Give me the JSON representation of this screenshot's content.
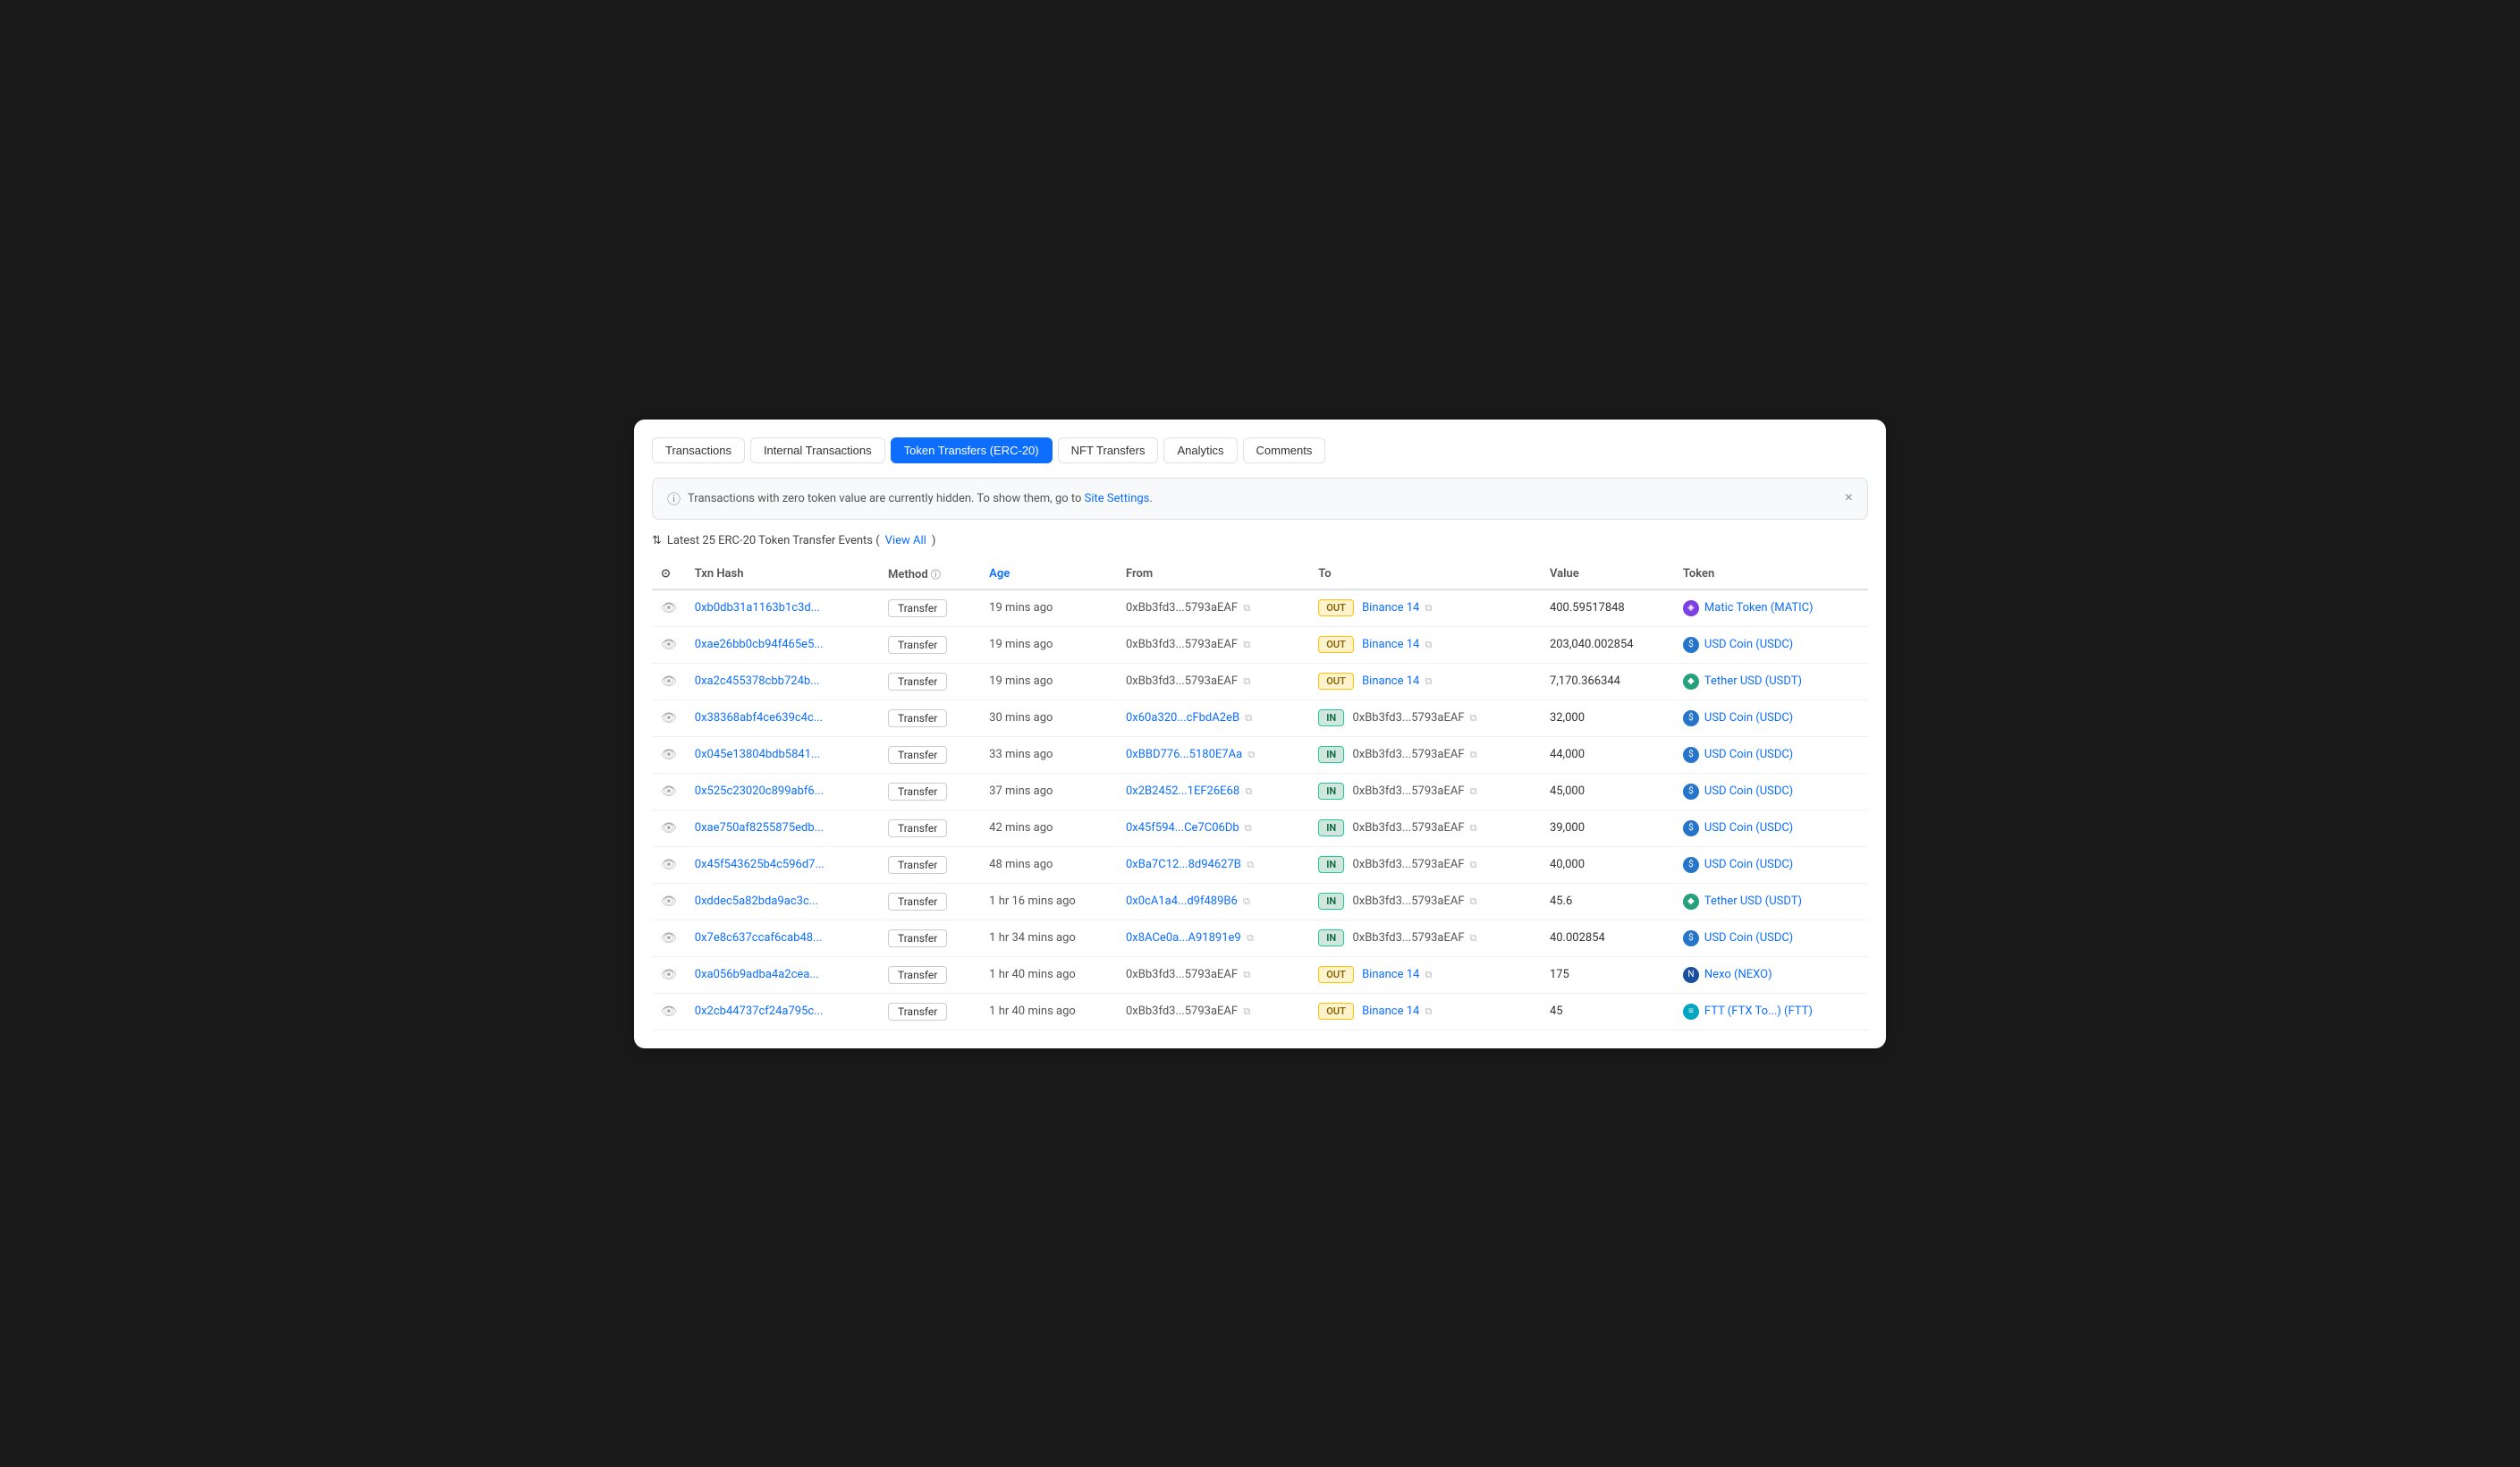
{
  "tabs": [
    {
      "label": "Transactions",
      "active": false
    },
    {
      "label": "Internal Transactions",
      "active": false
    },
    {
      "label": "Token Transfers (ERC-20)",
      "active": true
    },
    {
      "label": "NFT Transfers",
      "active": false
    },
    {
      "label": "Analytics",
      "active": false
    },
    {
      "label": "Comments",
      "active": false
    }
  ],
  "alert": {
    "message": "Transactions with zero token value are currently hidden. To show them, go to ",
    "link_text": "Site Settings",
    "link_url": "#"
  },
  "subtitle": {
    "prefix": "Latest 25 ERC-20 Token Transfer Events (",
    "link_text": "View All",
    "suffix": ")"
  },
  "columns": [
    {
      "label": "",
      "key": "checkbox"
    },
    {
      "label": "Txn Hash",
      "key": "txhash"
    },
    {
      "label": "Method",
      "key": "method",
      "has_info": true
    },
    {
      "label": "Age",
      "key": "age",
      "sortable": true
    },
    {
      "label": "From",
      "key": "from"
    },
    {
      "label": "",
      "key": "direction"
    },
    {
      "label": "To",
      "key": "to"
    },
    {
      "label": "Value",
      "key": "value"
    },
    {
      "label": "Token",
      "key": "token"
    }
  ],
  "rows": [
    {
      "txhash": "0xb0db31a1163b1c3d...",
      "method": "Transfer",
      "age": "19 mins ago",
      "from": "0xBb3fd3...5793aEAF",
      "direction": "OUT",
      "to": "Binance 14",
      "to_is_label": true,
      "value": "400.59517848",
      "token_name": "Matic Token",
      "token_symbol": "MATIC",
      "token_type": "matic"
    },
    {
      "txhash": "0xae26bb0cb94f465e5...",
      "method": "Transfer",
      "age": "19 mins ago",
      "from": "0xBb3fd3...5793aEAF",
      "direction": "OUT",
      "to": "Binance 14",
      "to_is_label": true,
      "value": "203,040.002854",
      "token_name": "USD Coin",
      "token_symbol": "USDC",
      "token_type": "usdc"
    },
    {
      "txhash": "0xa2c455378cbb724b...",
      "method": "Transfer",
      "age": "19 mins ago",
      "from": "0xBb3fd3...5793aEAF",
      "direction": "OUT",
      "to": "Binance 14",
      "to_is_label": true,
      "value": "7,170.366344",
      "token_name": "Tether USD",
      "token_symbol": "USDT",
      "token_type": "usdt"
    },
    {
      "txhash": "0x38368abf4ce639c4c...",
      "method": "Transfer",
      "age": "30 mins ago",
      "from": "0x60a320...cFbdA2eB",
      "from_is_link": true,
      "direction": "IN",
      "to": "0xBb3fd3...5793aEAF",
      "to_is_label": false,
      "value": "32,000",
      "token_name": "USD Coin",
      "token_symbol": "USDC",
      "token_type": "usdc"
    },
    {
      "txhash": "0x045e13804bdb5841...",
      "method": "Transfer",
      "age": "33 mins ago",
      "from": "0xBBD776...5180E7Aa",
      "from_is_link": true,
      "direction": "IN",
      "to": "0xBb3fd3...5793aEAF",
      "to_is_label": false,
      "value": "44,000",
      "token_name": "USD Coin",
      "token_symbol": "USDC",
      "token_type": "usdc"
    },
    {
      "txhash": "0x525c23020c899abf6...",
      "method": "Transfer",
      "age": "37 mins ago",
      "from": "0x2B2452...1EF26E68",
      "from_is_link": true,
      "direction": "IN",
      "to": "0xBb3fd3...5793aEAF",
      "to_is_label": false,
      "value": "45,000",
      "token_name": "USD Coin",
      "token_symbol": "USDC",
      "token_type": "usdc"
    },
    {
      "txhash": "0xae750af8255875edb...",
      "method": "Transfer",
      "age": "42 mins ago",
      "from": "0x45f594...Ce7C06Db",
      "from_is_link": true,
      "direction": "IN",
      "to": "0xBb3fd3...5793aEAF",
      "to_is_label": false,
      "value": "39,000",
      "token_name": "USD Coin",
      "token_symbol": "USDC",
      "token_type": "usdc"
    },
    {
      "txhash": "0x45f543625b4c596d7...",
      "method": "Transfer",
      "age": "48 mins ago",
      "from": "0xBa7C12...8d94627B",
      "from_is_link": true,
      "direction": "IN",
      "to": "0xBb3fd3...5793aEAF",
      "to_is_label": false,
      "value": "40,000",
      "token_name": "USD Coin",
      "token_symbol": "USDC",
      "token_type": "usdc"
    },
    {
      "txhash": "0xddec5a82bda9ac3c...",
      "method": "Transfer",
      "age": "1 hr 16 mins ago",
      "from": "0x0cA1a4...d9f489B6",
      "from_is_link": true,
      "direction": "IN",
      "to": "0xBb3fd3...5793aEAF",
      "to_is_label": false,
      "value": "45.6",
      "token_name": "Tether USD",
      "token_symbol": "USDT",
      "token_type": "usdt"
    },
    {
      "txhash": "0x7e8c637ccaf6cab48...",
      "method": "Transfer",
      "age": "1 hr 34 mins ago",
      "from": "0x8ACe0a...A91891e9",
      "from_is_link": true,
      "direction": "IN",
      "to": "0xBb3fd3...5793aEAF",
      "to_is_label": false,
      "value": "40.002854",
      "token_name": "USD Coin",
      "token_symbol": "USDC",
      "token_type": "usdc"
    },
    {
      "txhash": "0xa056b9adba4a2cea...",
      "method": "Transfer",
      "age": "1 hr 40 mins ago",
      "from": "0xBb3fd3...5793aEAF",
      "direction": "OUT",
      "to": "Binance 14",
      "to_is_label": true,
      "value": "175",
      "token_name": "Nexo",
      "token_symbol": "NEXO",
      "token_type": "nexo"
    },
    {
      "txhash": "0x2cb44737cf24a795c...",
      "method": "Transfer",
      "age": "1 hr 40 mins ago",
      "from": "0xBb3fd3...5793aEAF",
      "direction": "OUT",
      "to": "Binance 14",
      "to_is_label": true,
      "value": "45",
      "token_name": "FTT (FTX To...)",
      "token_symbol": "FTT",
      "token_type": "ftt"
    }
  ],
  "icons": {
    "filter": "⇅",
    "info_circle": "ⓘ",
    "copy": "⧉",
    "eye": "👁",
    "close": "×"
  }
}
